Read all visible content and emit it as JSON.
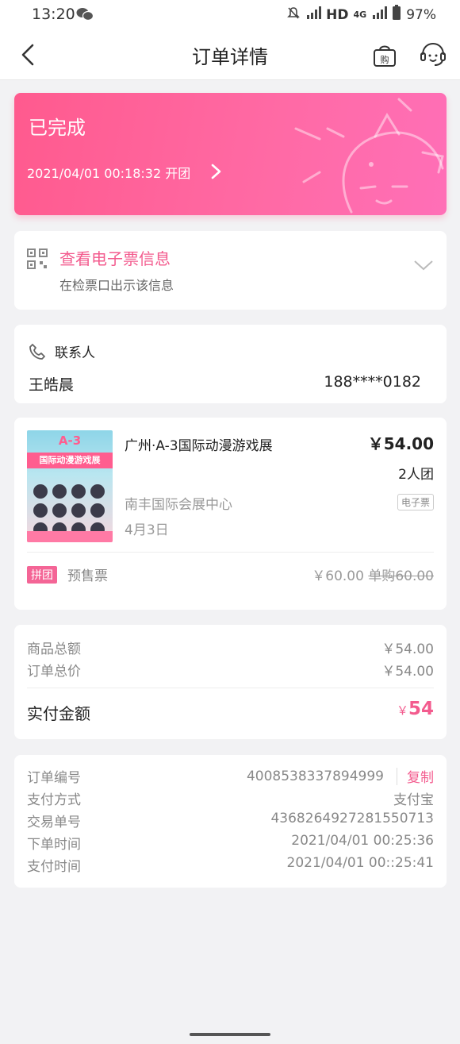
{
  "status_bar": {
    "time": "13:20",
    "network": "HD",
    "network_type": "4G",
    "battery": "97%"
  },
  "navbar": {
    "title": "订单详情",
    "icons": [
      "back-icon",
      "shopping-bag-icon",
      "customer-service-icon"
    ]
  },
  "order_status": {
    "status": "已完成",
    "group_time": "2021/04/01 00:18:32 开团",
    "accent": "#ff5a8e"
  },
  "eticket": {
    "title": "查看电子票信息",
    "subtitle": "在检票口出示该信息"
  },
  "contact": {
    "label": "联系人",
    "name": "王皓晨",
    "phone": "188****0182"
  },
  "product": {
    "poster_title": "A-3",
    "poster_banner": "国际动漫游戏展",
    "name": "广州·A-3国际动漫游戏展",
    "price": "￥54.00",
    "group": "2人团",
    "venue": "南丰国际会展中心",
    "ticket_type": "电子票",
    "date": "4月3日",
    "tag": "拼团",
    "presale": "预售票",
    "original_price": "￥60.00",
    "single_buy": "单购60.00"
  },
  "totals": {
    "goods_total_label": "商品总额",
    "goods_total": "￥54.00",
    "order_total_label": "订单总价",
    "order_total": "￥54.00",
    "paid_label": "实付金额",
    "paid_currency": "￥",
    "paid_amount": "54"
  },
  "order_info": {
    "order_no_label": "订单编号",
    "order_no": "4008538337894999",
    "copy": "复制",
    "pay_method_label": "支付方式",
    "pay_method": "支付宝",
    "trade_no_label": "交易单号",
    "trade_no": "4368264927281550713",
    "order_time_label": "下单时间",
    "order_time": "2021/04/01 00:25:36",
    "pay_time_label": "支付时间",
    "pay_time": "2021/04/01 00::25:41"
  }
}
